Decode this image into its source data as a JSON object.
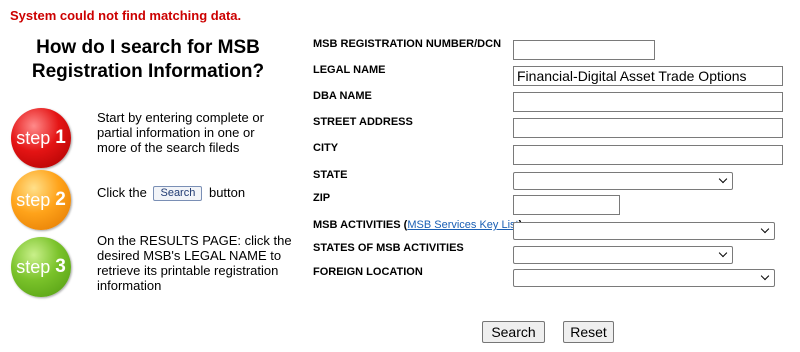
{
  "error": "System could not find matching data.",
  "howto": {
    "title_line1": "How do I search for MSB",
    "title_line2": "Registration Information?"
  },
  "steps": [
    {
      "badge_word": "step",
      "badge_num": "1",
      "color": "#e41414",
      "text": "Start by entering complete or partial information in one or more of the search fileds"
    },
    {
      "badge_word": "step",
      "badge_num": "2",
      "color": "#ffa31a",
      "text_before": "Click the",
      "button_label": "Search",
      "text_after": "button"
    },
    {
      "badge_word": "step",
      "badge_num": "3",
      "color": "#7ac22a",
      "text": "On the RESULTS PAGE: click the desired MSB's LEGAL NAME to retrieve its printable registration information"
    }
  ],
  "form": {
    "registration_number": {
      "label": "MSB REGISTRATION NUMBER/DCN",
      "value": ""
    },
    "legal_name": {
      "label": "LEGAL NAME",
      "value": "Financial-Digital Asset Trade Options"
    },
    "dba_name": {
      "label": "DBA NAME",
      "value": ""
    },
    "street_address": {
      "label": "STREET ADDRESS",
      "value": ""
    },
    "city": {
      "label": "CITY",
      "value": ""
    },
    "state": {
      "label": "STATE",
      "value": ""
    },
    "zip": {
      "label": "ZIP",
      "value": ""
    },
    "msb_activities": {
      "label": "MSB ACTIVITIES",
      "link_text": "MSB Services Key List",
      "open_paren": "(",
      "close_paren": ")",
      "value": ""
    },
    "states_of_msb_activities": {
      "label": "STATES OF MSB ACTIVITIES",
      "value": ""
    },
    "foreign_location": {
      "label": "FOREIGN LOCATION",
      "value": ""
    },
    "search_button": "Search",
    "reset_button": "Reset"
  }
}
